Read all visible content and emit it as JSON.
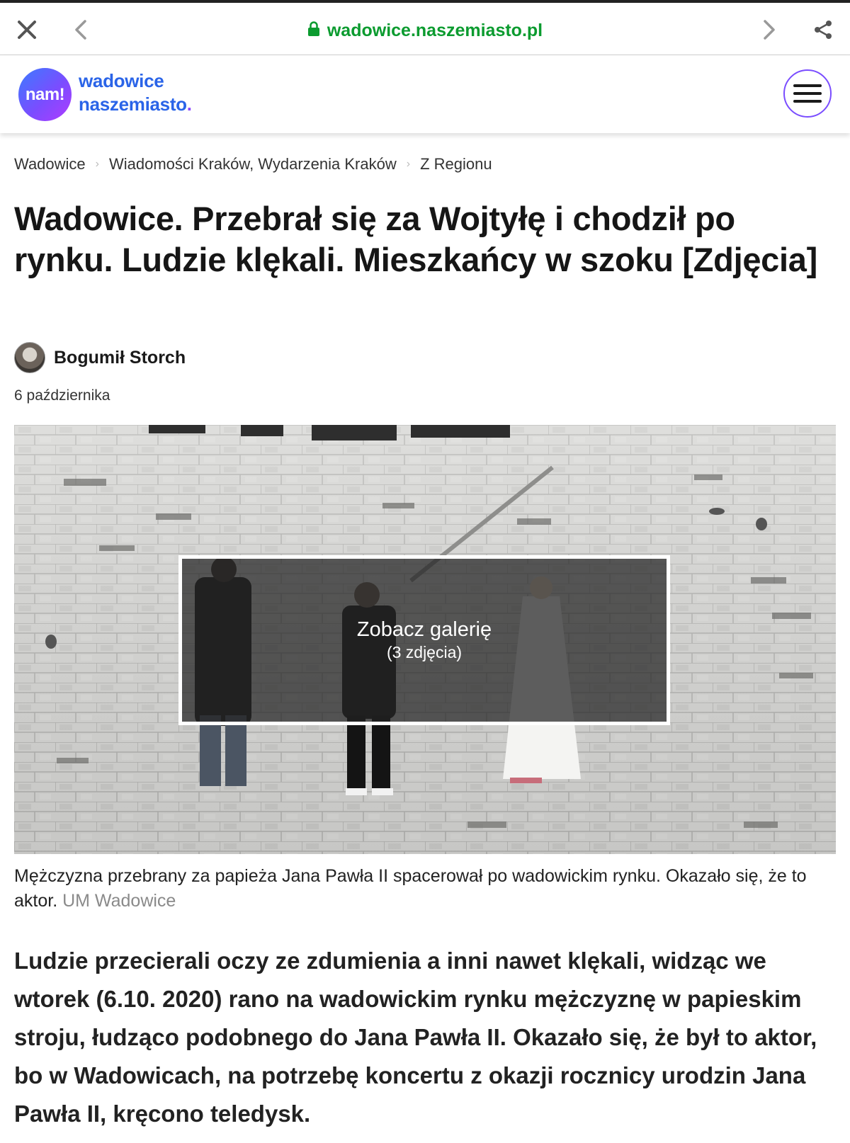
{
  "browser": {
    "url": "wadowice.naszemiasto.pl",
    "icons": [
      "close-icon",
      "back-icon",
      "lock-icon",
      "forward-icon",
      "share-icon"
    ],
    "url_color": "#0b9b2f"
  },
  "header": {
    "logo_badge": "nam!",
    "logo_line1": "wadowice",
    "logo_line2": "naszemiasto",
    "logo_dot": ".",
    "accent": "#2a64e8",
    "menu_icon": "hamburger-menu-icon"
  },
  "breadcrumb": {
    "items": [
      {
        "label": "Wadowice"
      },
      {
        "label": "Wiadomości Kraków, Wydarzenia Kraków"
      },
      {
        "label": "Z Regionu"
      }
    ]
  },
  "article": {
    "title": "Wadowice. Przebrał się za Wojtyłę i chodził po rynku. Ludzie klękali. Mieszkańcy w szoku [Zdjęcia]",
    "author": "Bogumił Storch",
    "date": "6 października",
    "gallery": {
      "label": "Zobacz galerię",
      "count": "(3 zdjęcia)"
    },
    "caption": "Mężczyzna przebrany za papieża Jana Pawła II spacerował po wadowickim rynku. Okazało się, że to aktor.",
    "caption_source": "UM Wadowice",
    "lead": "Ludzie przecierali oczy ze zdumienia a inni nawet klękali, widząc we wtorek (6.10. 2020) rano na wadowickim rynku mężczyznę w papieskim stroju, łudząco podobnego do Jana Pawła II. Okazało się, że był to aktor, bo w Wadowicach, na potrzebę koncertu z okazji rocznicy urodzin Jana Pawła II, kręcono teledysk."
  }
}
